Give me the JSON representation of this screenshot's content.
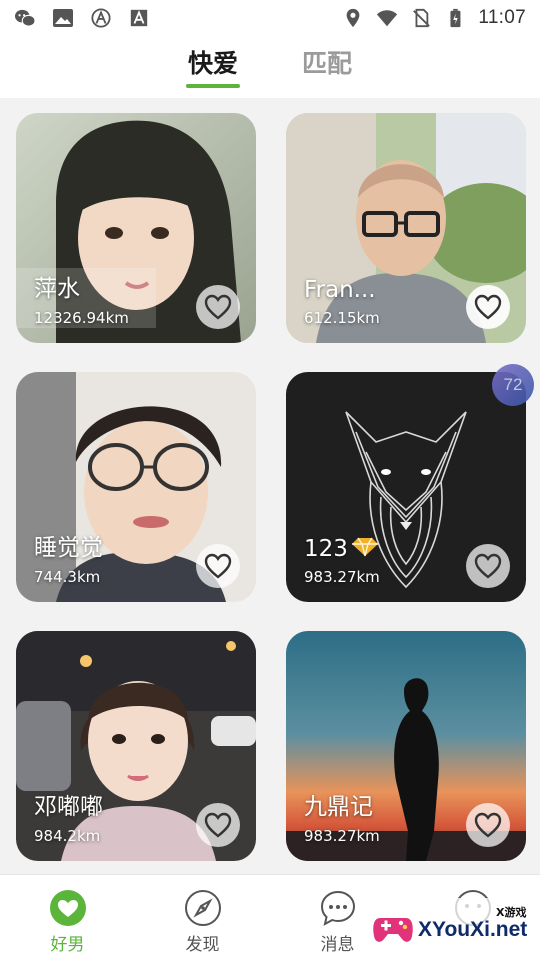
{
  "status_bar": {
    "time": "11:07",
    "left_icons": [
      "wechat-icon",
      "image-icon",
      "app-logo-icon",
      "text-a-icon"
    ],
    "right_icons": [
      "location-icon",
      "wifi-icon",
      "no-sim-icon",
      "battery-charging-icon"
    ]
  },
  "top_tabs": [
    {
      "label": "快爱",
      "active": true
    },
    {
      "label": "匹配",
      "active": false
    }
  ],
  "cards": [
    {
      "name": "萍水",
      "distance": "12326.94km",
      "image": "girl-portrait-1"
    },
    {
      "name": "Fran...",
      "distance": "612.15km",
      "image": "man-garden-glasses"
    },
    {
      "name": "睡觉觉",
      "distance": "744.3km",
      "image": "boy-glasses-portrait"
    },
    {
      "name": "123",
      "distance": "983.27km",
      "image": "wolf-illustration",
      "badge_icon": "gold-gem-icon",
      "corner_badge": "72"
    },
    {
      "name": "邓嘟嘟",
      "distance": "984.2km",
      "image": "girl-night-street"
    },
    {
      "name": "九鼎记",
      "distance": "983.27km",
      "image": "silhouette-sunset"
    }
  ],
  "bottom_nav": [
    {
      "label": "好男",
      "icon": "heart-circle-icon",
      "active": true
    },
    {
      "label": "发现",
      "icon": "compass-icon",
      "active": false
    },
    {
      "label": "消息",
      "icon": "chat-bubble-icon",
      "active": false
    },
    {
      "label": "",
      "icon": "profile-icon",
      "active": false
    }
  ],
  "watermark": {
    "small": "X游戏",
    "text": "XYouXi.net"
  },
  "colors": {
    "accent": "#5bb53a",
    "background": "#f2f2f2"
  }
}
